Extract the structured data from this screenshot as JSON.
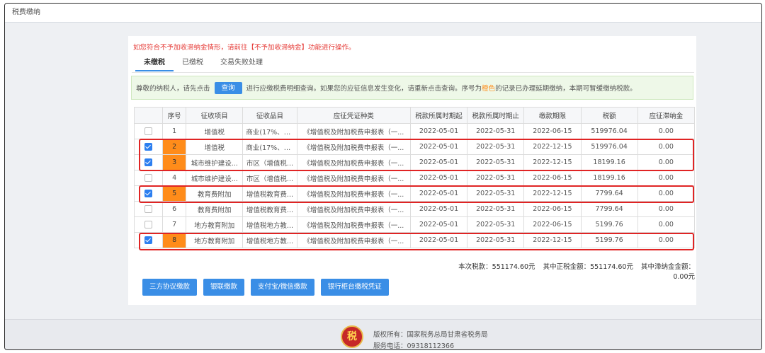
{
  "window": {
    "title": "税费缴纳"
  },
  "warning": "如您符合不予加收滞纳金情形，请前往【不予加收滞纳金】功能进行操作。",
  "tabs": [
    {
      "label": "未缴税",
      "active": true
    },
    {
      "label": "已缴税",
      "active": false
    },
    {
      "label": "交易失败处理",
      "active": false
    }
  ],
  "notice": {
    "prefix": "尊敬的纳税人，请先点击",
    "query_button": "查询",
    "text_mid": "进行应缴税费明细查询。如果您的应征信息发生变化，请重新点击查询。序号为",
    "highlight_word": "橙色",
    "text_end": "的记录已办理延期缴纳，本期可暂缓缴纳税款。"
  },
  "table": {
    "headers": [
      "",
      "序号",
      "征收项目",
      "征收品目",
      "应征凭证种类",
      "税款所属时期起",
      "税款所属时期止",
      "缴款期限",
      "税额",
      "应征滞纳金"
    ],
    "rows": [
      {
        "checked": false,
        "highlight": false,
        "seq": "1",
        "item": "增值税",
        "sub": "商业(17%、1...",
        "voucher": "《增值税及附加税费申报表（一...",
        "start": "2022-05-01",
        "end": "2022-05-31",
        "deadline": "2022-06-15",
        "tax": "519976.04",
        "late_fee": "0.00"
      },
      {
        "checked": true,
        "highlight": true,
        "seq": "2",
        "item": "增值税",
        "sub": "商业(17%、1...",
        "voucher": "《增值税及附加税费申报表（一...",
        "start": "2022-05-01",
        "end": "2022-05-31",
        "deadline": "2022-12-15",
        "tax": "519976.04",
        "late_fee": "0.00"
      },
      {
        "checked": true,
        "highlight": true,
        "seq": "3",
        "item": "城市维护建设...",
        "sub": "市区（增值税...",
        "voucher": "《增值税及附加税费申报表（一...",
        "start": "2022-05-01",
        "end": "2022-05-31",
        "deadline": "2022-12-15",
        "tax": "18199.16",
        "late_fee": "0.00"
      },
      {
        "checked": false,
        "highlight": false,
        "seq": "4",
        "item": "城市维护建设...",
        "sub": "市区（增值税...",
        "voucher": "《增值税及附加税费申报表（一...",
        "start": "2022-05-01",
        "end": "2022-05-31",
        "deadline": "2022-06-15",
        "tax": "18199.16",
        "late_fee": "0.00"
      },
      {
        "checked": true,
        "highlight": true,
        "seq": "5",
        "item": "教育费附加",
        "sub": "增值税教育费...",
        "voucher": "《增值税及附加税费申报表（一...",
        "start": "2022-05-01",
        "end": "2022-05-31",
        "deadline": "2022-12-15",
        "tax": "7799.64",
        "late_fee": "0.00"
      },
      {
        "checked": false,
        "highlight": false,
        "seq": "6",
        "item": "教育费附加",
        "sub": "增值税教育费...",
        "voucher": "《增值税及附加税费申报表（一...",
        "start": "2022-05-01",
        "end": "2022-05-31",
        "deadline": "2022-06-15",
        "tax": "7799.64",
        "late_fee": "0.00"
      },
      {
        "checked": false,
        "highlight": false,
        "seq": "7",
        "item": "地方教育附加",
        "sub": "增值税地方教...",
        "voucher": "《增值税及附加税费申报表（一...",
        "start": "2022-05-01",
        "end": "2022-05-31",
        "deadline": "2022-06-15",
        "tax": "5199.76",
        "late_fee": "0.00"
      },
      {
        "checked": true,
        "highlight": true,
        "seq": "8",
        "item": "地方教育附加",
        "sub": "增值税地方教...",
        "voucher": "《增值税及附加税费申报表（一...",
        "start": "2022-05-01",
        "end": "2022-05-31",
        "deadline": "2022-12-15",
        "tax": "5199.76",
        "late_fee": "0.00"
      }
    ]
  },
  "totals": {
    "tax": "本次税款：551174.60元",
    "principal": "其中正税金额：551174.60元",
    "late": "其中滞纳金金额：0.00元"
  },
  "buttons": [
    "三方协议缴款",
    "银联缴款",
    "支付宝/微信缴款",
    "银行柜台缴税凭证"
  ],
  "footer": {
    "logo_text": "税",
    "copyright": "版权所有：国家税务总局甘肃省税务局",
    "phone": "服务电话：09318112366"
  },
  "colors": {
    "accent": "#3a8ee6",
    "deferred_highlight": "#ff8c1a",
    "annotation_box": "#e02424",
    "warning_text": "#e53935"
  }
}
